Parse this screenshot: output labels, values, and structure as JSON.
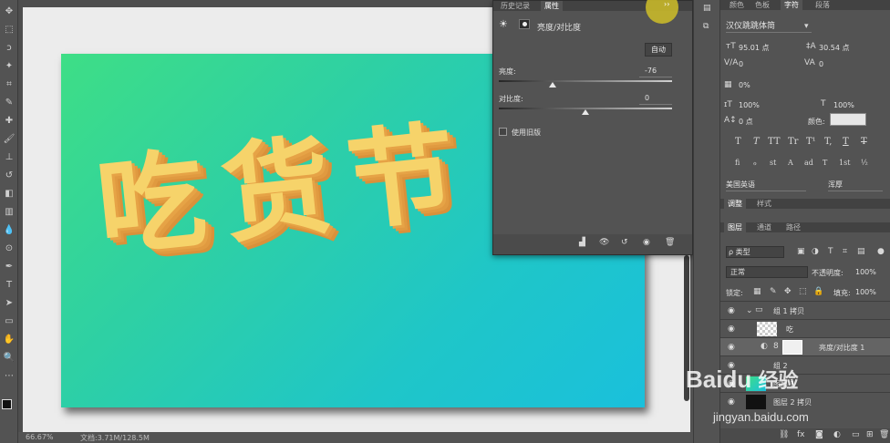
{
  "tools": {
    "icons": [
      "move-icon",
      "marquee-icon",
      "lasso-icon",
      "magic-wand-icon",
      "crop-icon",
      "eyedropper-icon",
      "healing-brush-icon",
      "brush-icon",
      "stamp-icon",
      "history-brush-icon",
      "eraser-icon",
      "gradient-icon",
      "blur-icon",
      "dodge-icon",
      "pen-icon",
      "type-icon",
      "path-select-icon",
      "rectangle-icon",
      "hand-icon",
      "zoom-icon",
      "more-icon"
    ],
    "glyphs": [
      "✥",
      "⬚",
      "ↄ",
      "✦",
      "⌗",
      "✎",
      "✚",
      "🖌",
      "⊥",
      "↺",
      "◧",
      "▥",
      "💧",
      "⊙",
      "✒",
      "T",
      "➤",
      "▭",
      "✋",
      "🔍",
      "⋯"
    ]
  },
  "canvas": {
    "headline": "吃货节"
  },
  "status": {
    "zoom": "66.67%",
    "doc_size": "文档:3.71M/128.5M"
  },
  "properties": {
    "tabs": [
      "历史记录",
      "属性"
    ],
    "collapse_label": "››",
    "adjustment_title": "亮度/对比度",
    "auto_label": "自动",
    "brightness_label": "亮度:",
    "brightness_value": "-76",
    "brightness_fraction": 0.31,
    "contrast_label": "对比度:",
    "contrast_value": "0",
    "contrast_fraction": 0.5,
    "legacy_label": "使用旧版"
  },
  "character": {
    "tabs": [
      "颜色",
      "色板",
      "字符",
      "段落"
    ],
    "font_family": "汉仪跳跳体简",
    "font_size": "95.01 点",
    "leading": "30.54 点",
    "kerning": "0",
    "tracking": "0",
    "tsume": "0%",
    "vscale": "100%",
    "hscale": "100%",
    "baseline": "0 点",
    "color_label": "颜色:",
    "style_buttons": [
      "T",
      "T",
      "TT",
      "Tr",
      "T¹",
      "T,",
      "T",
      "T"
    ],
    "extra_buttons": [
      "fi",
      "ℴ",
      "st",
      "A",
      "ad",
      "T",
      "1st",
      "½"
    ],
    "language": "美国英语",
    "aa": "浑厚"
  },
  "adjust_tabs": [
    "调整",
    "样式"
  ],
  "layers": {
    "tabs": [
      "图层",
      "通道",
      "路径"
    ],
    "filter": "ρ 类型",
    "blend": "正常",
    "opacity_label": "不透明度:",
    "opacity": "100%",
    "lock_label": "锁定:",
    "fill_label": "填充:",
    "fill": "100%",
    "items": [
      {
        "name": "组 1 拷贝",
        "type": "group"
      },
      {
        "name": "吃",
        "type": "text"
      },
      {
        "name": "亮度/对比度 1",
        "type": "adjust"
      },
      {
        "name": "组 2",
        "type": "group"
      },
      {
        "name": "图层 1",
        "type": "layer"
      },
      {
        "name": "图层 2 拷贝",
        "type": "layer"
      }
    ]
  },
  "watermark": {
    "brand": "Baidu",
    "text": "经验",
    "url": "jingyan.baidu.com"
  },
  "colors": {
    "accent": "#c8b82a",
    "bg": "#535353",
    "gradient_start": "#3ede86",
    "gradient_end": "#1ac0dc",
    "headline": "#f6d36a"
  }
}
